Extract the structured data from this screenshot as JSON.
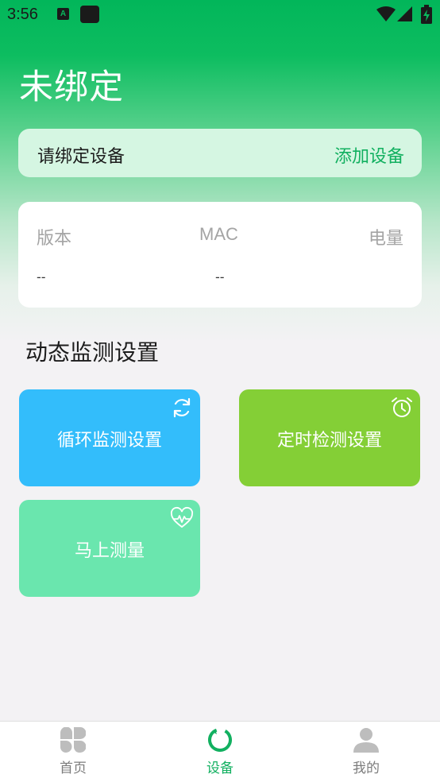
{
  "status_bar": {
    "time": "3:56",
    "notif_a": "A"
  },
  "page": {
    "title": "未绑定"
  },
  "bind_card": {
    "label": "请绑定设备",
    "action": "添加设备"
  },
  "device_info": {
    "version_label": "版本",
    "mac_label": "MAC",
    "battery_label": "电量",
    "version_value": "--",
    "mac_value": "--"
  },
  "monitoring": {
    "section_title": "动态监测设置",
    "tiles": [
      {
        "label": "循环监测设置",
        "icon": "refresh-icon",
        "color": "#33bdfb"
      },
      {
        "label": "定时检测设置",
        "icon": "alarm-clock-icon",
        "color": "#84cf36"
      },
      {
        "label": "马上测量",
        "icon": "heart-pulse-icon",
        "color": "#6ae6ae"
      }
    ]
  },
  "bottom_nav": {
    "items": [
      {
        "label": "首页",
        "icon": "four-petal-icon"
      },
      {
        "label": "设备",
        "icon": "device-ring-icon",
        "active": true
      },
      {
        "label": "我的",
        "icon": "user-icon"
      }
    ],
    "active_color": "#12b060"
  }
}
